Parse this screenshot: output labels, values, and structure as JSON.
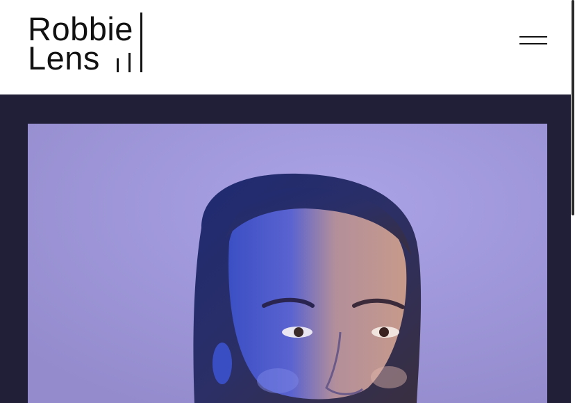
{
  "brand": {
    "line1": "Robbie",
    "line2": "Lens"
  },
  "header": {
    "menu_icon": "hamburger-menu-icon"
  },
  "hero": {
    "image_name": "portrait-photo"
  },
  "colors": {
    "header_bg": "#ffffff",
    "main_bg": "#211f37",
    "photo_bg": "#a29cd9",
    "text": "#111111"
  }
}
